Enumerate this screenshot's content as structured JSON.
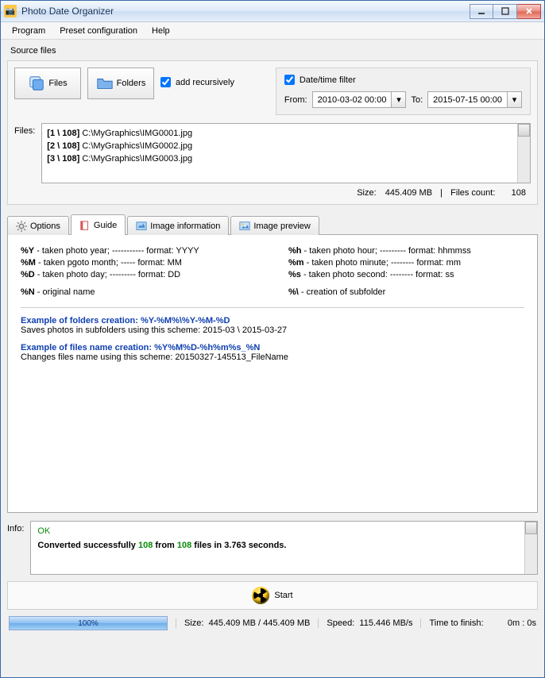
{
  "window": {
    "title": "Photo Date Organizer"
  },
  "menu": {
    "program": "Program",
    "preset": "Preset configuration",
    "help": "Help"
  },
  "source": {
    "section_label": "Source files",
    "files_btn": "Files",
    "folders_btn": "Folders",
    "add_recursively": "add recursively",
    "datetime_filter_label": "Date/time filter",
    "from_label": "From:",
    "from_value": "2010-03-02 00:00",
    "to_label": "To:",
    "to_value": "2015-07-15 00:00",
    "files_label": "Files:",
    "file_list": [
      {
        "idx": "[1 \\ 108]",
        "path": "C:\\MyGraphics\\IMG0001.jpg"
      },
      {
        "idx": "[2 \\ 108]",
        "path": "C:\\MyGraphics\\IMG0002.jpg"
      },
      {
        "idx": "[3 \\ 108]",
        "path": "C:\\MyGraphics\\IMG0003.jpg"
      }
    ],
    "size_label": "Size:",
    "size_value": "445.409 MB",
    "count_label": "Files count:",
    "count_value": "108"
  },
  "tabs": {
    "options": "Options",
    "guide": "Guide",
    "image_info": "Image information",
    "image_preview": "Image preview"
  },
  "guide": {
    "y": "%Y - taken photo year; ----------- format: YYYY",
    "M": "%M - taken pgoto month; ----- format: MM",
    "D": "%D - taken photo day; --------- format: DD",
    "N": "%N - original name",
    "h": "%h - taken photo hour; --------- format: hhmmss",
    "m": "%m - taken photo minute; -------- format: mm",
    "s": "%s - taken photo second: -------- format: ss",
    "slash": "%\\ - creation of subfolder",
    "ex_folders_title": "Example of folders creation: %Y-%M%\\%Y-%M-%D",
    "ex_folders_desc": "Saves photos in subfolders using this scheme: 2015-03 \\ 2015-03-27",
    "ex_files_title": "Example of files name creation: %Y%M%D-%h%m%s_%N",
    "ex_files_desc": "Changes files name using this scheme: 20150327-145513_FileName"
  },
  "info": {
    "label": "Info:",
    "ok": "OK",
    "line_prefix": "Converted successfully ",
    "line_n1": "108",
    "line_mid": " from ",
    "line_n2": "108",
    "line_suffix": " files in 3.763 seconds."
  },
  "start": {
    "label": "Start"
  },
  "status": {
    "progress_pct": "100%",
    "size_label": "Size:",
    "size_value": "445.409 MB  /  445.409 MB",
    "speed_label": "Speed:",
    "speed_value": "115.446 MB/s",
    "ttf_label": "Time to finish:",
    "ttf_value": "0m : 0s"
  }
}
